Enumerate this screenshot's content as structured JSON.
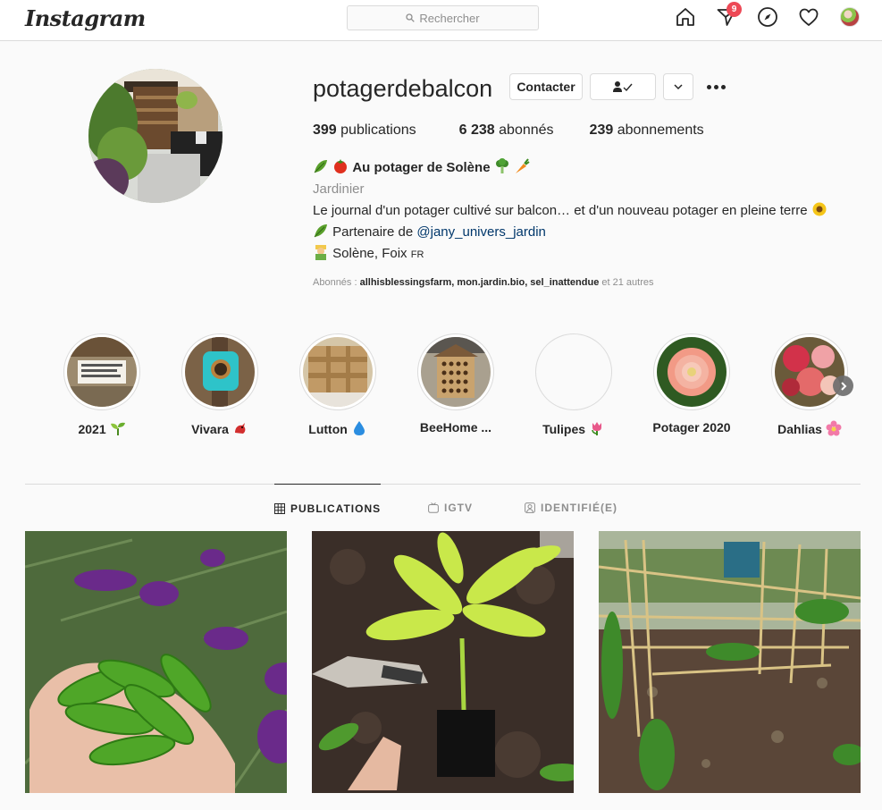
{
  "nav": {
    "logo": "Instagram",
    "search_placeholder": "Rechercher",
    "icons": [
      "home-icon",
      "direct-icon",
      "explore-icon",
      "activity-heart-icon",
      "profile-avatar"
    ],
    "notification_count": "9"
  },
  "profile": {
    "username": "potagerdebalcon",
    "contact_label": "Contacter",
    "stats": [
      {
        "value": "399",
        "label": "publications"
      },
      {
        "value": "6 238",
        "label": "abonnés"
      },
      {
        "value": "239",
        "label": "abonnements"
      }
    ],
    "bio": {
      "name": "Au potager de Solène",
      "category": "Jardinier",
      "line1": "Le journal d'un potager cultivé sur balcon… et d'un nouveau potager en pleine terre",
      "partner_prefix": "Partenaire de ",
      "partner_link": "@jany_univers_jardin",
      "location": "Solène, Foix",
      "location_flag": "FR"
    },
    "followed_by": {
      "prefix": "Abonnés : ",
      "users": "allhisblessingsfarm, mon.jardin.bio, sel_inattendue",
      "suffix": " et 21 autres"
    }
  },
  "stories": [
    {
      "label": "2021"
    },
    {
      "label": "Vivara"
    },
    {
      "label": "Lutton"
    },
    {
      "label": "BeeHome ..."
    },
    {
      "label": "Tulipes"
    },
    {
      "label": "Potager 2020"
    },
    {
      "label": "Dahlias"
    }
  ],
  "tabs": [
    {
      "label": "PUBLICATIONS",
      "active": true
    },
    {
      "label": "IGTV",
      "active": false
    },
    {
      "label": "IDENTIFIÉ(E)",
      "active": false
    }
  ],
  "posts": [
    {
      "subject": "snow peas in hand with lavender"
    },
    {
      "subject": "pepper seedling being planted"
    },
    {
      "subject": "bamboo trellis garden bed"
    }
  ],
  "colors": {
    "accent_link": "#00376b",
    "badge": "#ed4956",
    "muted": "#8e8e8e",
    "border": "#dbdbdb"
  }
}
